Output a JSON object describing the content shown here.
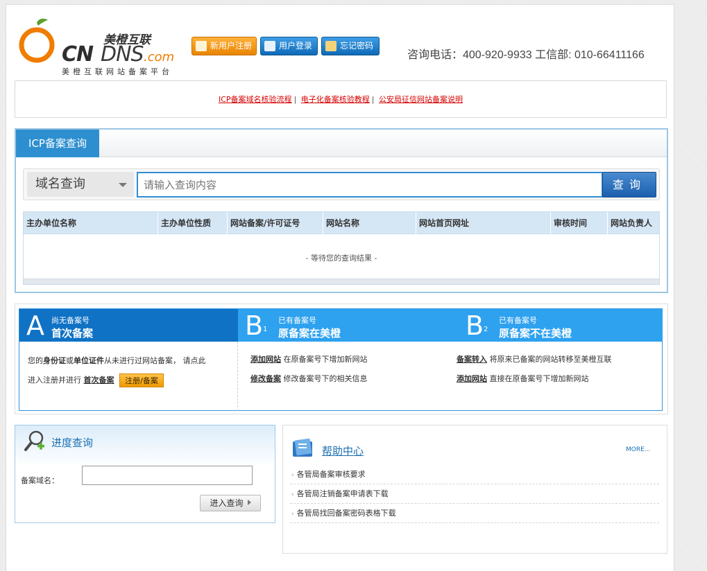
{
  "brand": {
    "cn_name": "美橙互联",
    "logo_cn": "CN",
    "logo_dns": "DNS",
    "logo_com": ".com",
    "slogan": "美橙互联网站备案平台",
    "orange_color": "#f07c00"
  },
  "header": {
    "register_label": "新用户注册",
    "login_label": "用户登录",
    "forgot_label": "忘记密码",
    "hotline": "咨询电话：400-920-9933 工信部: 010-66411166"
  },
  "links": [
    {
      "label": "ICP备案域名核验流程"
    },
    {
      "label": "电子化备案核验教程"
    },
    {
      "label": "公安局征信网站备案说明"
    }
  ],
  "icp": {
    "tab_label": "ICP备案查询",
    "select_value": "域名查询",
    "input_placeholder": "请输入查询内容",
    "query_label": "查询",
    "columns": [
      "主办单位名称",
      "主办单位性质",
      "网站备案/许可证号",
      "网站名称",
      "网站首页网址",
      "审核时间",
      "网站负责人"
    ],
    "empty_text": "- 等待您的查询结果 -"
  },
  "ab": {
    "a": {
      "letter": "A",
      "small": "尚无备案号",
      "title": "首次备案",
      "text_1": "您的",
      "bold_1": "身份证",
      "text_2": "或",
      "bold_2": "单位证件",
      "text_3": "从未进行过网站备案， 请点此",
      "text_4": "进入注册并进行",
      "link": "首次备案",
      "button": "注册/备案"
    },
    "b1": {
      "letter": "B",
      "num": "1",
      "small": "已有备案号",
      "title": "原备案在美橙",
      "rows": [
        {
          "link": "添加网站",
          "text": "在原备案号下增加新网站"
        },
        {
          "link": "修改备案",
          "text": "修改备案号下的相关信息"
        }
      ]
    },
    "b2": {
      "letter": "B",
      "num": "2",
      "small": "已有备案号",
      "title": "原备案不在美橙",
      "rows": [
        {
          "link": "备案转入",
          "text": "将原来已备案的网站转移至美橙互联"
        },
        {
          "link": "添加网站",
          "text": "直接在原备案号下增加新网站"
        }
      ]
    }
  },
  "progress": {
    "title": "进度查询",
    "label": "备案域名：",
    "button": "进入查询"
  },
  "help": {
    "title": "帮助中心",
    "more": "MORE...",
    "items": [
      "各管局备案审核要求",
      "各管局注销备案申请表下载",
      "各管局找回备案密码表格下载"
    ]
  }
}
